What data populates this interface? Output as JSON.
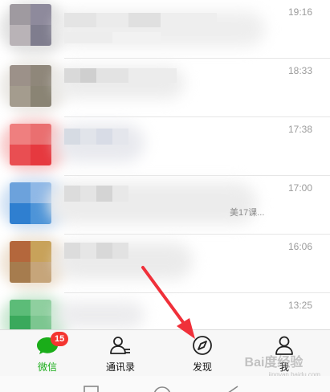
{
  "chats": [
    {
      "time": "19:16",
      "snippet": ""
    },
    {
      "time": "18:33",
      "snippet": ""
    },
    {
      "time": "17:38",
      "snippet": ""
    },
    {
      "time": "17:00",
      "snippet": "美17课..."
    },
    {
      "time": "16:06",
      "snippet": ""
    },
    {
      "time": "13:25",
      "snippet": ""
    }
  ],
  "tabbar": {
    "tabs": [
      {
        "label": "微信",
        "icon": "chat-bubble-icon",
        "badge": "15",
        "active": true
      },
      {
        "label": "通讯录",
        "icon": "contacts-icon"
      },
      {
        "label": "发现",
        "icon": "compass-icon"
      },
      {
        "label": "我",
        "icon": "person-icon"
      }
    ]
  },
  "watermark": {
    "brand": "Bai度经验",
    "url": "jingyan.baidu.com"
  },
  "colors": {
    "accent": "#1aad19",
    "badge": "#f43530",
    "annotation_arrow": "#f0303a"
  }
}
